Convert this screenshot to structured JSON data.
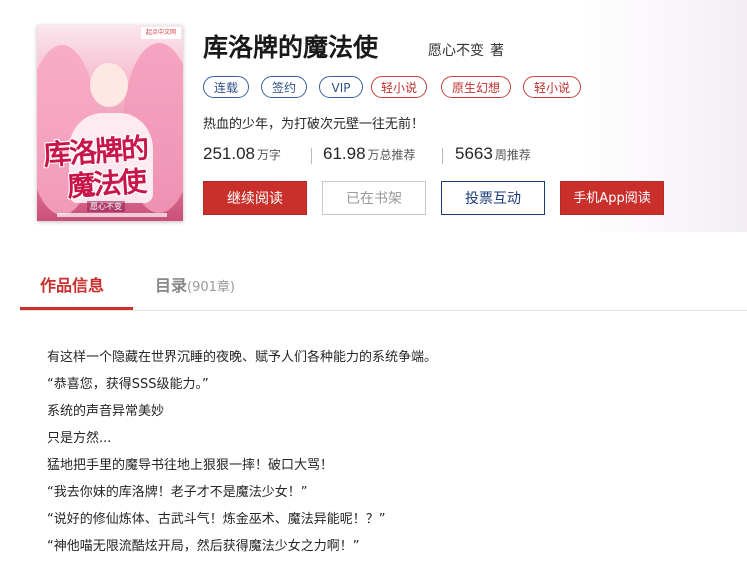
{
  "cover": {
    "publisher_badge": "起点中文网",
    "title_line1": "库洛牌的",
    "title_line2": "魔法使",
    "author": "愿心不变"
  },
  "book": {
    "title": "库洛牌的魔法使",
    "author": "愿心不变",
    "author_role": "著",
    "intro": "热血的少年，为打破次元壁一往无前！"
  },
  "tags": [
    "连载",
    "签约",
    "VIP",
    "轻小说",
    "原生幻想",
    "轻小说"
  ],
  "stats": [
    {
      "num": "251.08",
      "unit": "万字"
    },
    {
      "num": "61.98",
      "unit": "万总推荐"
    },
    {
      "num": "5663",
      "unit": "周推荐"
    }
  ],
  "buttons": {
    "read": "继续阅读",
    "shelf": "已在书架",
    "vote": "投票互动",
    "app": "手机App阅读"
  },
  "tabs": {
    "info": "作品信息",
    "toc": "目录",
    "toc_count": "(901章)"
  },
  "content": [
    "有这样一个隐藏在世界沉睡的夜晚、赋予人们各种能力的系统争端。",
    "“恭喜您，获得SSS级能力。”",
    "系统的声音异常美妙",
    "只是方然...",
    "猛地把手里的魔导书往地上狠狠一摔！破口大骂！",
    "“我去你妹的库洛牌！老子才不是魔法少女！”",
    "“说好的修仙炼体、古武斗气！炼金巫术、魔法异能呢！？”",
    "“神他喵无限流酷炫开局，然后获得魔法少女之力啊！”"
  ],
  "colors": {
    "accent_red": "#c9302c",
    "tag_blue": "#3a5f9e",
    "tag_red": "#c84040"
  }
}
